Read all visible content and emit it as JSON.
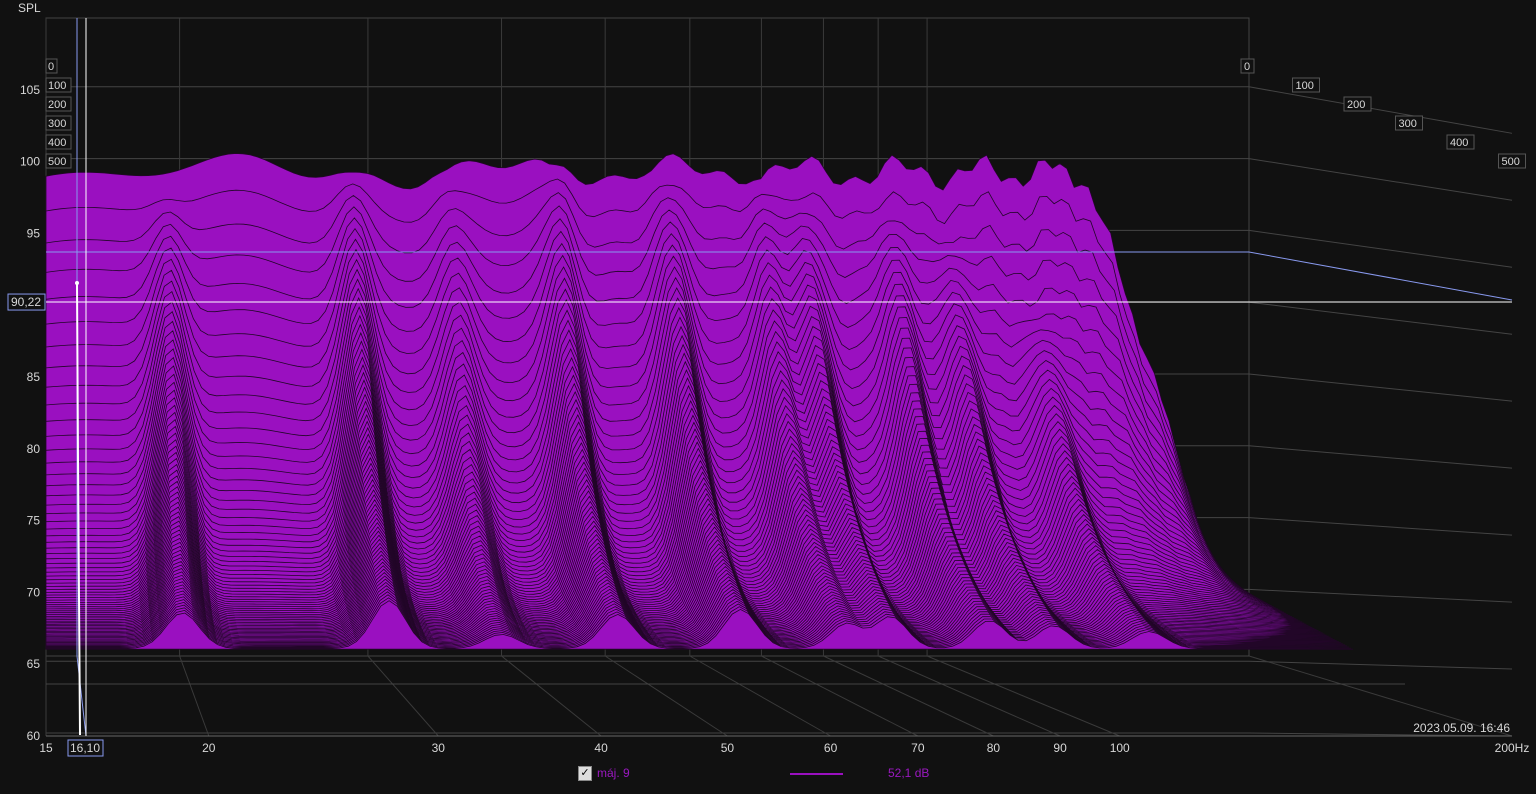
{
  "chart_data": {
    "type": "waterfall",
    "ylabel": "SPL",
    "xunit": "Hz",
    "ylim": [
      60,
      108
    ],
    "xlim": [
      15,
      200
    ],
    "y_ticks": [
      "60",
      "65",
      "70",
      "75",
      "80",
      "85",
      "90",
      "95",
      "100",
      "105"
    ],
    "x_ticks": [
      {
        "f": 15,
        "label": "15"
      },
      {
        "f": 20,
        "label": "20"
      },
      {
        "f": 30,
        "label": "30"
      },
      {
        "f": 40,
        "label": "40"
      },
      {
        "f": 50,
        "label": "50"
      },
      {
        "f": 60,
        "label": "60"
      },
      {
        "f": 70,
        "label": "70"
      },
      {
        "f": 80,
        "label": "80"
      },
      {
        "f": 90,
        "label": "90"
      },
      {
        "f": 100,
        "label": "100"
      },
      {
        "f": 200,
        "label": "200Hz"
      }
    ],
    "time_ticks_ms": [
      "0",
      "100",
      "200",
      "300",
      "400",
      "500"
    ],
    "time_range_ms": [
      0,
      500
    ],
    "floor_db": 65,
    "initial_level_db": 93,
    "modes": [
      {
        "f": 19.5,
        "decay_ms": 320,
        "level_db": 92
      },
      {
        "f": 29,
        "decay_ms": 380,
        "level_db": 93
      },
      {
        "f": 36,
        "decay_ms": 200,
        "level_db": 93
      },
      {
        "f": 45,
        "decay_ms": 300,
        "level_db": 93.5
      },
      {
        "f": 57,
        "decay_ms": 330,
        "level_db": 93
      },
      {
        "f": 70,
        "decay_ms": 260,
        "level_db": 92.5
      },
      {
        "f": 76,
        "decay_ms": 300,
        "level_db": 92
      },
      {
        "f": 92,
        "decay_ms": 280,
        "level_db": 91.5
      },
      {
        "f": 104,
        "decay_ms": 260,
        "level_db": 90
      },
      {
        "f": 125,
        "decay_ms": 240,
        "level_db": 87
      }
    ],
    "cursor": {
      "x_label": "16,10",
      "y_label": "90,22",
      "freq": 16.1,
      "spl": 90.22
    },
    "timestamp": "2023.05.09. 16:46",
    "legend": {
      "name": "máj. 9",
      "checked": true,
      "value": "52,1 dB",
      "color": "#9a10c0"
    }
  }
}
